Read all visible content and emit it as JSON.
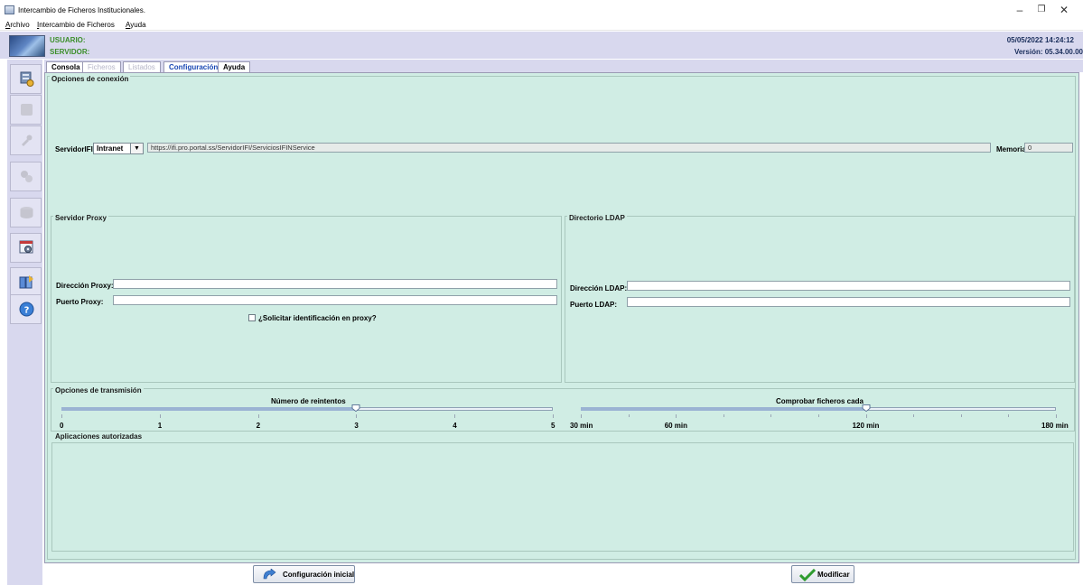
{
  "window": {
    "title": "Intercambio de Ficheros Institucionales.",
    "minimize_glyph": "–",
    "maximize_glyph": "❐",
    "close_glyph": "✕"
  },
  "menu": [
    {
      "label": "Archivo",
      "mnemonic": "A"
    },
    {
      "label": "Intercambio de Ficheros",
      "mnemonic": "I"
    },
    {
      "label": "Ayuda",
      "mnemonic": "A"
    }
  ],
  "header": {
    "usuario_label": "USUARIO:",
    "servidor_label": "SERVIDOR:",
    "fecha": "05/05/2022  14:24:12",
    "version": "Versión:  05.34.00.00"
  },
  "toolbar": {
    "items": [
      {
        "icon": "server-config-icon",
        "enabled": true
      },
      {
        "icon": "folder-icon",
        "enabled": false
      },
      {
        "icon": "wrench-icon",
        "enabled": false
      },
      {
        "icon": "gears-icon",
        "enabled": false
      },
      {
        "icon": "disk-icon",
        "enabled": false
      },
      {
        "icon": "settings-window-icon",
        "enabled": true
      },
      {
        "icon": "exchange-icon",
        "enabled": true
      },
      {
        "icon": "help-icon",
        "enabled": true
      }
    ]
  },
  "tabs": [
    {
      "label": "Consola",
      "state": "normal"
    },
    {
      "label": "Ficheros",
      "state": "disabled"
    },
    {
      "label": "Listados",
      "state": "disabled"
    },
    {
      "label": "Configuración",
      "state": "active"
    },
    {
      "label": "Ayuda",
      "state": "normal"
    }
  ],
  "conexion": {
    "legend": "Opciones de conexión",
    "servidor_label": "ServidorIFI:",
    "servidor_tipo": "Intranet",
    "combo_arrow": "▼",
    "url": "https://ifi.pro.portal.ss/ServidorIFI/ServiciosIFINService",
    "memoria_label": "Memoria:",
    "memoria_value": "0"
  },
  "proxy": {
    "legend": "Servidor Proxy",
    "direccion_label": "Dirección Proxy:",
    "direccion_value": "",
    "puerto_label": "Puerto Proxy:",
    "puerto_value": "",
    "auth_label": "¿Solicitar identificación en proxy?",
    "auth_checked": false
  },
  "ldap": {
    "legend": "Directorio LDAP",
    "direccion_label": "Dirección LDAP:",
    "direccion_value": "",
    "puerto_label": "Puerto LDAP:",
    "puerto_value": ""
  },
  "transmision": {
    "legend": "Opciones de transmisión",
    "reintentos": {
      "title": "Número de reintentos",
      "min": 0,
      "max": 5,
      "value": 3,
      "ticks": [
        "0",
        "1",
        "2",
        "3",
        "4",
        "5"
      ]
    },
    "comprobar": {
      "title": "Comprobar ficheros cada",
      "min": 30,
      "max": 180,
      "value": 120,
      "ticks": [
        {
          "v": 30,
          "label": "30 min"
        },
        {
          "v": 60,
          "label": "60 min"
        },
        {
          "v": 120,
          "label": "120 min"
        },
        {
          "v": 180,
          "label": "180 min"
        }
      ],
      "minor_step": 15
    }
  },
  "aplicaciones": {
    "legend": "Aplicaciones autorizadas"
  },
  "buttons": {
    "reset_label": "Configuración inicial",
    "modify_label": "Modificar"
  },
  "colors": {
    "panel_bg": "#d0ede4",
    "header_bg": "#d8d8ee",
    "user_label": "#3b8e2a",
    "active_tab": "#1a48b4",
    "check_green": "#2e9b2e"
  }
}
